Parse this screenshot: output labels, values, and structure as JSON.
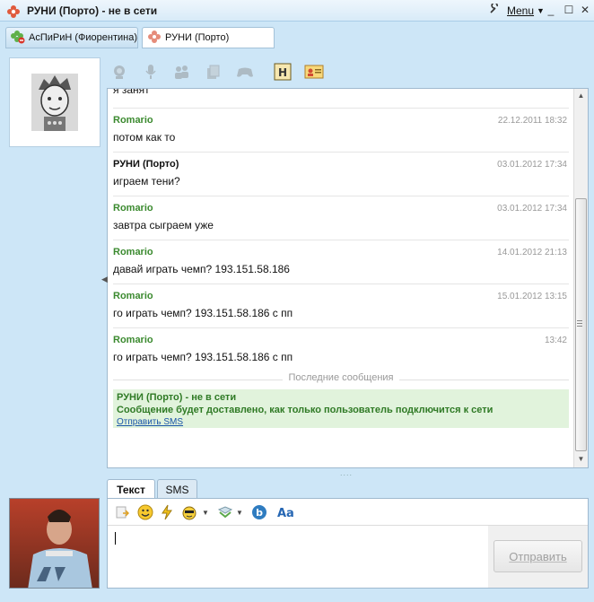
{
  "window": {
    "title": "РУНИ (Порто) - не в сети",
    "menu_label": "Menu",
    "buttons": [
      "minimize",
      "maximize",
      "close"
    ]
  },
  "tabs": [
    {
      "label": "АсПиРиН (Фиорентина)",
      "active": false,
      "status": "offline"
    },
    {
      "label": "РУНИ (Порто)",
      "active": true,
      "status": "offline"
    }
  ],
  "toolbar": {
    "icons": [
      "webcam-icon",
      "microphone-icon",
      "contacts-icon",
      "files-icon",
      "game-icon",
      "history-icon",
      "contact-card-icon"
    ]
  },
  "chat": {
    "partial_text": "я занят",
    "messages": [
      {
        "author": "Romario",
        "author_color": "#3b8a2f",
        "time": "22.12.2011 18:32",
        "text": "потом как то"
      },
      {
        "author": "РУНИ (Порто)",
        "author_color": "#111111",
        "time": "03.01.2012 17:34",
        "text": "играем тени?"
      },
      {
        "author": "Romario",
        "author_color": "#3b8a2f",
        "time": "03.01.2012 17:34",
        "text": "завтра сыграем уже"
      },
      {
        "author": "Romario",
        "author_color": "#3b8a2f",
        "time": "14.01.2012 21:13",
        "text": "давай играть чемп? 193.151.58.186"
      },
      {
        "author": "Romario",
        "author_color": "#3b8a2f",
        "time": "15.01.2012 13:15",
        "text": "го играть чемп? 193.151.58.186 с пп"
      },
      {
        "author": "Romario",
        "author_color": "#3b8a2f",
        "time": "13:42",
        "text": "го играть чемп? 193.151.58.186 с пп"
      }
    ],
    "separator": "Последние сообщения",
    "status_line1": "РУНИ (Порто) - не в сети",
    "status_line2": "Сообщение будет доставлено, как только пользователь подключится к сети",
    "sms_link": "Отправить SMS"
  },
  "input": {
    "tabs": [
      {
        "label": "Текст",
        "active": true
      },
      {
        "label": "SMS",
        "active": false
      }
    ],
    "value": "",
    "send_label": "Отправить"
  },
  "colors": {
    "background": "#cde6f7",
    "accent_green": "#3b8a2f",
    "status_bg": "#e1f3dc",
    "link": "#1a55a8"
  }
}
